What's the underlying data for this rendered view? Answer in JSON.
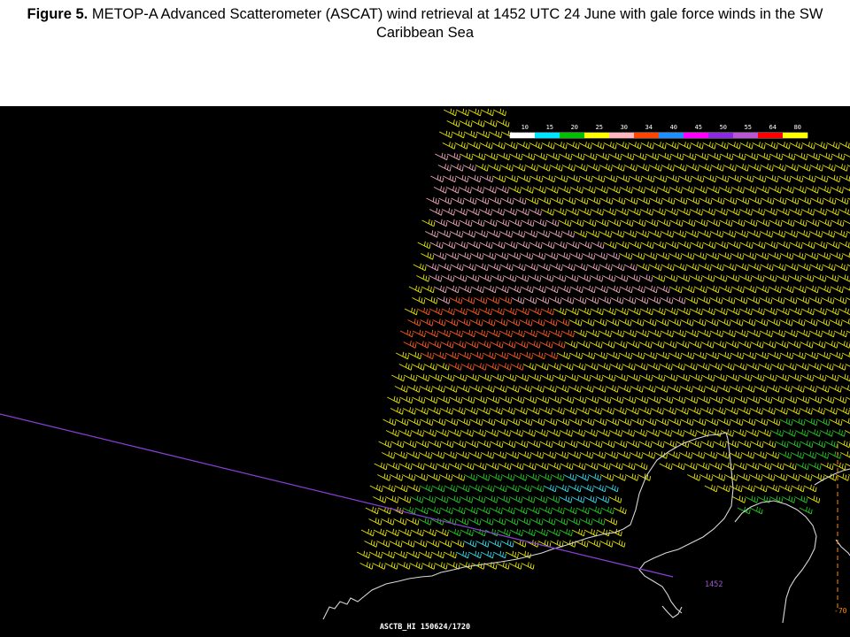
{
  "figure": {
    "label": "Figure 5.",
    "caption_line1": " METOP-A Advanced Scatterometer (ASCAT) wind retrieval at 1452 UTC 24 June with gale force winds in the SW",
    "caption_line2": "Caribbean Sea"
  },
  "legend": {
    "entries": [
      {
        "label": "10",
        "color": "#ffffff"
      },
      {
        "label": "15",
        "color": "#00e5ff"
      },
      {
        "label": "20",
        "color": "#00c000"
      },
      {
        "label": "25",
        "color": "#ffff00"
      },
      {
        "label": "30",
        "color": "#ffb6c1"
      },
      {
        "label": "34",
        "color": "#ff4500"
      },
      {
        "label": "40",
        "color": "#1e90ff"
      },
      {
        "label": "45",
        "color": "#ff00ff"
      },
      {
        "label": "50",
        "color": "#8a2be2"
      },
      {
        "label": "55",
        "color": "#ba55d3"
      },
      {
        "label": "64",
        "color": "#ff0000"
      },
      {
        "label": "80",
        "color": "#ffff00"
      }
    ]
  },
  "annotations": {
    "pass_time": "1452",
    "product_label": "ASCTB_HI  150624/1720",
    "longitude_label": "-70"
  },
  "colors": {
    "background": "#000000",
    "coastline": "#d8d8d8",
    "track_line": "#8a3fd6",
    "grid_line": "#ff8c00",
    "barb_yellow": "#e6e600",
    "barb_pink": "#f0a8b8",
    "barb_orange": "#ff5a1e",
    "barb_green": "#22cc22",
    "barb_cyan": "#30e0f0"
  }
}
